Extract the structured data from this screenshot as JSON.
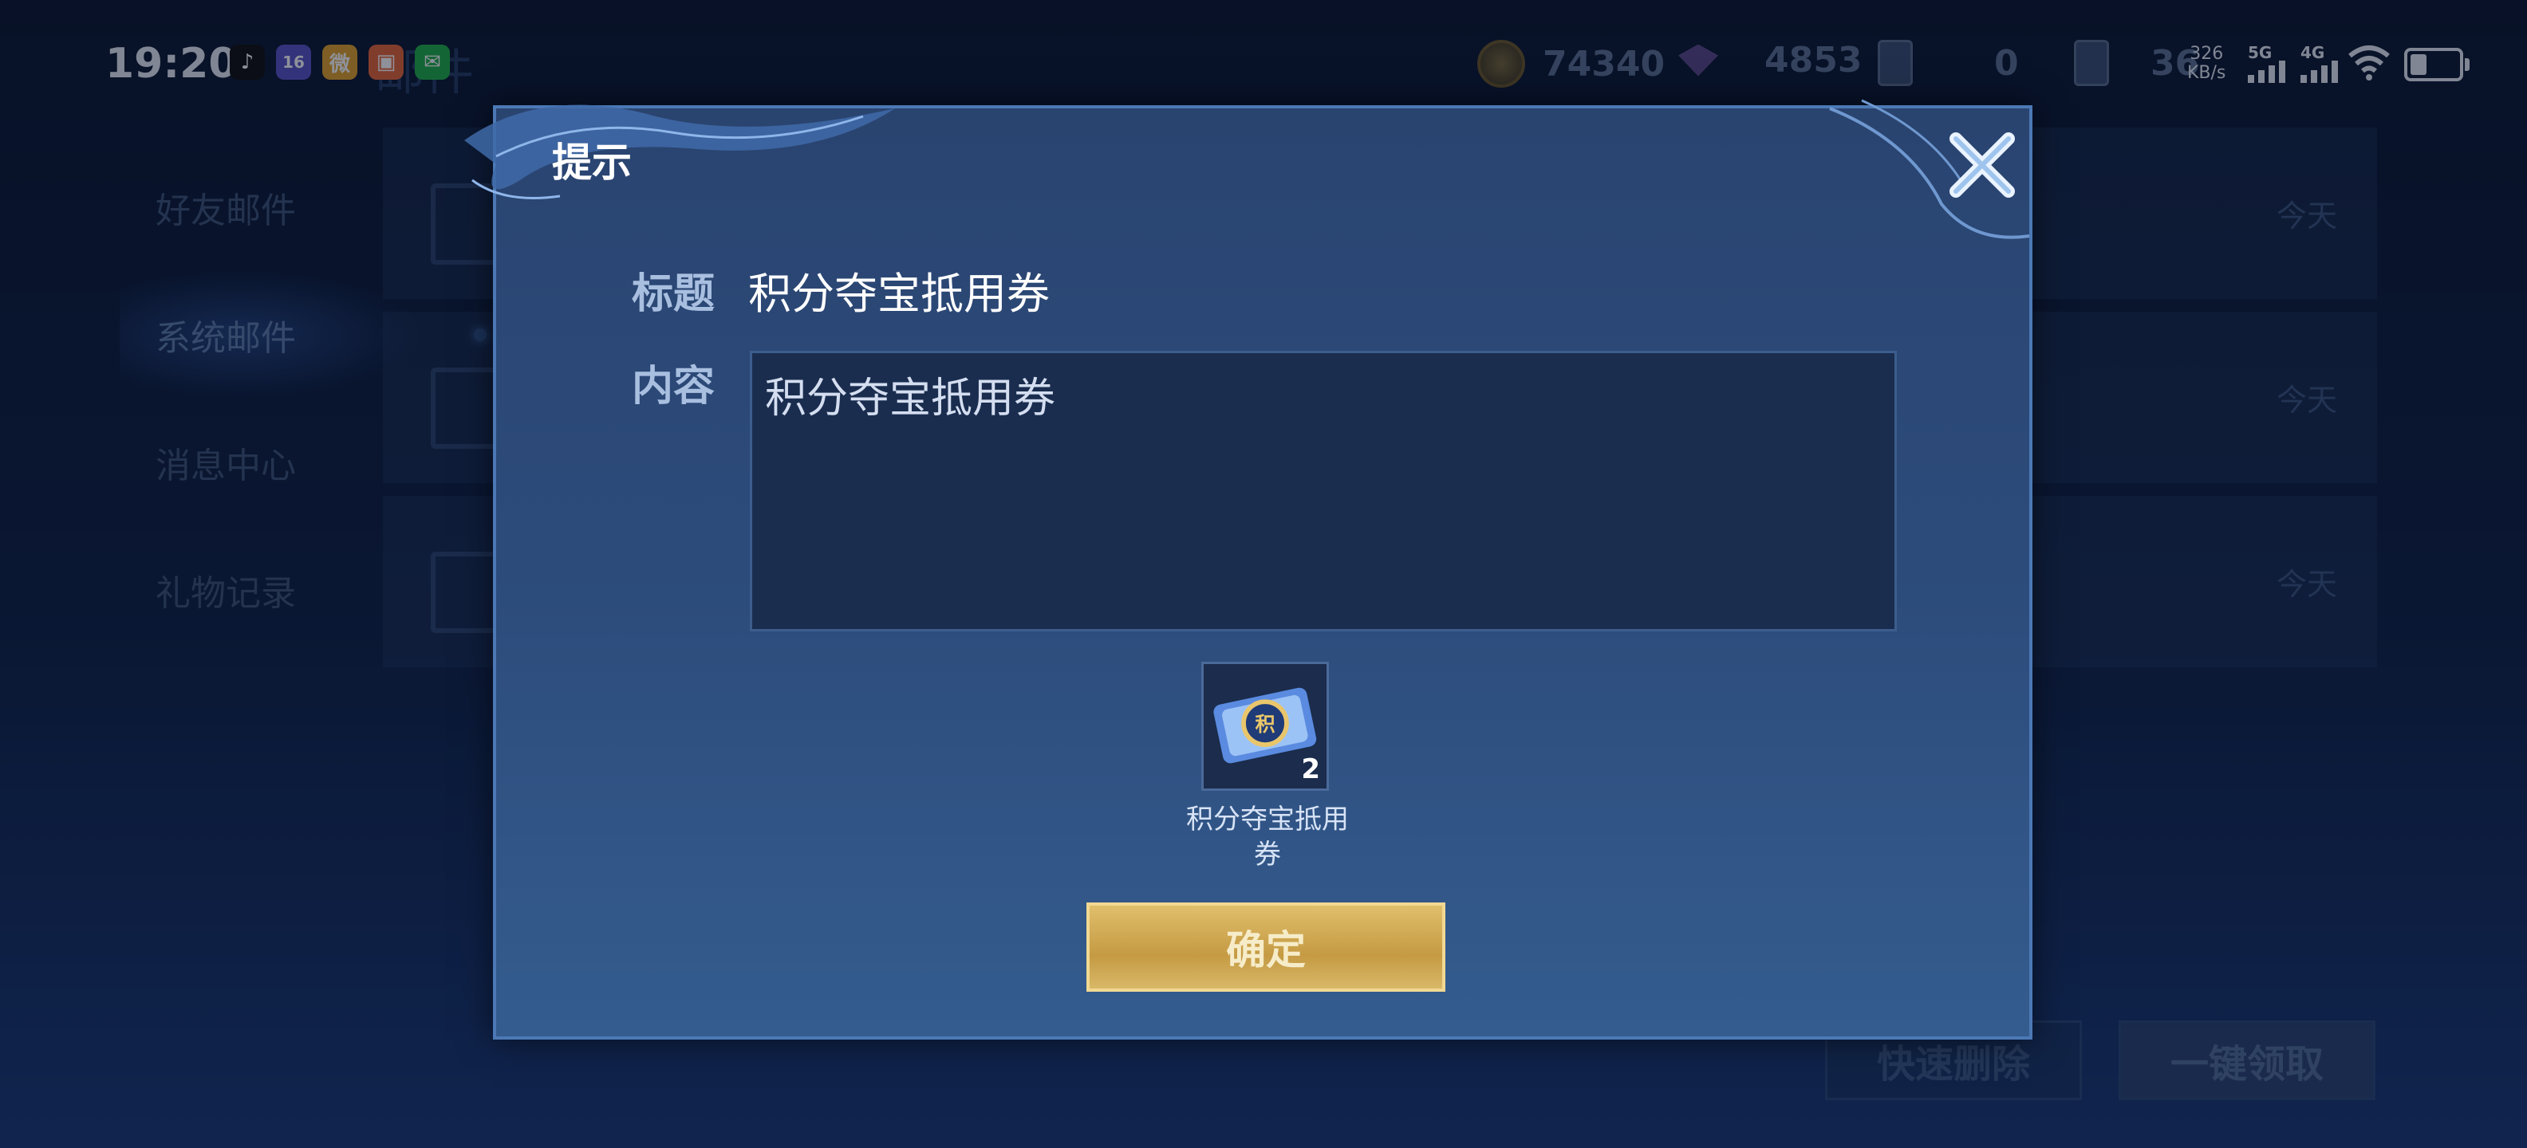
{
  "status_bar": {
    "time": "19:20",
    "apps": [
      {
        "name": "tiktok",
        "glyph": "♪",
        "color": "#111111"
      },
      {
        "name": "app-purple",
        "glyph": "16",
        "color": "#5a55c8"
      },
      {
        "name": "weibo",
        "glyph": "微",
        "color": "#e2a32a"
      },
      {
        "name": "app-orange",
        "glyph": "▣",
        "color": "#e8673a"
      },
      {
        "name": "wechat",
        "glyph": "✉",
        "color": "#22b04a"
      }
    ],
    "network_speed": "326",
    "network_unit": "KB/s",
    "sig1_label": "5G",
    "sig2_label": "4G"
  },
  "resources": {
    "gold": "74340",
    "diamond": "4853",
    "card": "0",
    "ticket": "36"
  },
  "background": {
    "page_title": "邮件",
    "sidebar": [
      "好友邮件",
      "系统邮件",
      "消息中心",
      "礼物记录"
    ],
    "rows": [
      {
        "date": "今天"
      },
      {
        "date": "今天"
      },
      {
        "date": "今天"
      }
    ],
    "delete_all": "快速删除",
    "claim_all": "一键领取"
  },
  "dialog": {
    "title": "提示",
    "title_label": "标题",
    "title_value": "积分夺宝抵用券",
    "content_label": "内容",
    "content_value": "积分夺宝抵用券",
    "item": {
      "name_line1": "积分夺宝抵用",
      "name_line2": "券",
      "count": "2"
    },
    "confirm_label": "确定"
  },
  "colors": {
    "accent_gold": "#d7b25c",
    "panel": "#2c4b7b",
    "border": "#4c79b5"
  }
}
